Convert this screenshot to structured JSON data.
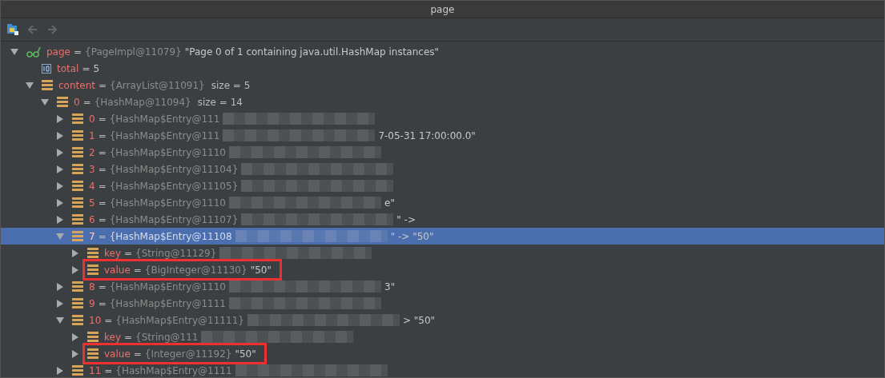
{
  "window": {
    "title": "page"
  },
  "tree": [
    {
      "kind": "root",
      "name": "page",
      "eq": "=",
      "type": "{PageImpl@11079}",
      "value": "\"Page 0 of 1 containing java.util.HashMap instances\"",
      "expanded": true,
      "selected": false,
      "children": [
        {
          "kind": "primitive",
          "name": "total",
          "eq": "=",
          "value": "5",
          "selected": false
        },
        {
          "kind": "object",
          "name": "content",
          "eq": "=",
          "type": "{ArrayList@11091}",
          "size": "size = 5",
          "expanded": true,
          "selected": false,
          "children": [
            {
              "kind": "object",
              "name": "0",
              "eq": "=",
              "type": "{HashMap@11094}",
              "size": "size = 14",
              "expanded": true,
              "selected": false,
              "children": [
                {
                  "kind": "object",
                  "name": "0",
                  "eq": "=",
                  "type": "{HashMap$Entry@111",
                  "redacted": true,
                  "expanded": false,
                  "selected": false
                },
                {
                  "kind": "object",
                  "name": "1",
                  "eq": "=",
                  "type": "{HashMap$Entry@111",
                  "redacted": true,
                  "tail": "7-05-31 17:00:00.0\"",
                  "expanded": false,
                  "selected": false
                },
                {
                  "kind": "object",
                  "name": "2",
                  "eq": "=",
                  "type": "{HashMap$Entry@1110",
                  "redacted": true,
                  "expanded": false,
                  "selected": false
                },
                {
                  "kind": "object",
                  "name": "3",
                  "eq": "=",
                  "type": "{HashMap$Entry@11104}",
                  "redacted": true,
                  "expanded": false,
                  "selected": false
                },
                {
                  "kind": "object",
                  "name": "4",
                  "eq": "=",
                  "type": "{HashMap$Entry@11105}",
                  "redacted": true,
                  "expanded": false,
                  "selected": false
                },
                {
                  "kind": "object",
                  "name": "5",
                  "eq": "=",
                  "type": "{HashMap$Entry@1110",
                  "redacted": true,
                  "tail": "e\"",
                  "expanded": false,
                  "selected": false
                },
                {
                  "kind": "object",
                  "name": "6",
                  "eq": "=",
                  "type": "{HashMap$Entry@11107}",
                  "redacted": true,
                  "tail": "\" ->",
                  "expanded": false,
                  "selected": false
                },
                {
                  "kind": "object",
                  "name": "7",
                  "eq": "=",
                  "type": "{HashMap$Entry@11108",
                  "redacted": true,
                  "tail": "\" -> \"50\"",
                  "expanded": true,
                  "selected": true,
                  "children": [
                    {
                      "kind": "object",
                      "name": "key",
                      "eq": "=",
                      "type": "{String@11129}",
                      "redacted": true,
                      "expanded": false,
                      "selected": false
                    },
                    {
                      "kind": "object",
                      "name": "value",
                      "eq": "=",
                      "type": "{BigInteger@11130}",
                      "value": "\"50\"",
                      "highlighted": true,
                      "expanded": false,
                      "selected": false
                    }
                  ]
                },
                {
                  "kind": "object",
                  "name": "8",
                  "eq": "=",
                  "type": "{HashMap$Entry@1110",
                  "redacted": true,
                  "tail": "3\"",
                  "expanded": false,
                  "selected": false
                },
                {
                  "kind": "object",
                  "name": "9",
                  "eq": "=",
                  "type": "{HashMap$Entry@1111",
                  "redacted": true,
                  "expanded": false,
                  "selected": false
                },
                {
                  "kind": "object",
                  "name": "10",
                  "eq": "=",
                  "type": "{HashMap$Entry@11111}",
                  "redacted": true,
                  "tail": "> \"50\"",
                  "expanded": true,
                  "selected": false,
                  "children": [
                    {
                      "kind": "object",
                      "name": "key",
                      "eq": "=",
                      "type": "{String@111",
                      "redacted": true,
                      "expanded": false,
                      "selected": false
                    },
                    {
                      "kind": "object",
                      "name": "value",
                      "eq": "=",
                      "type": "{Integer@11192}",
                      "value": "\"50\"",
                      "highlighted": true,
                      "expanded": false,
                      "selected": false
                    }
                  ]
                },
                {
                  "kind": "object",
                  "name": "11",
                  "eq": "=",
                  "type": "{HashMap$Entry@1111",
                  "redacted": true,
                  "expanded": false,
                  "selected": false
                }
              ]
            }
          ]
        }
      ]
    }
  ]
}
